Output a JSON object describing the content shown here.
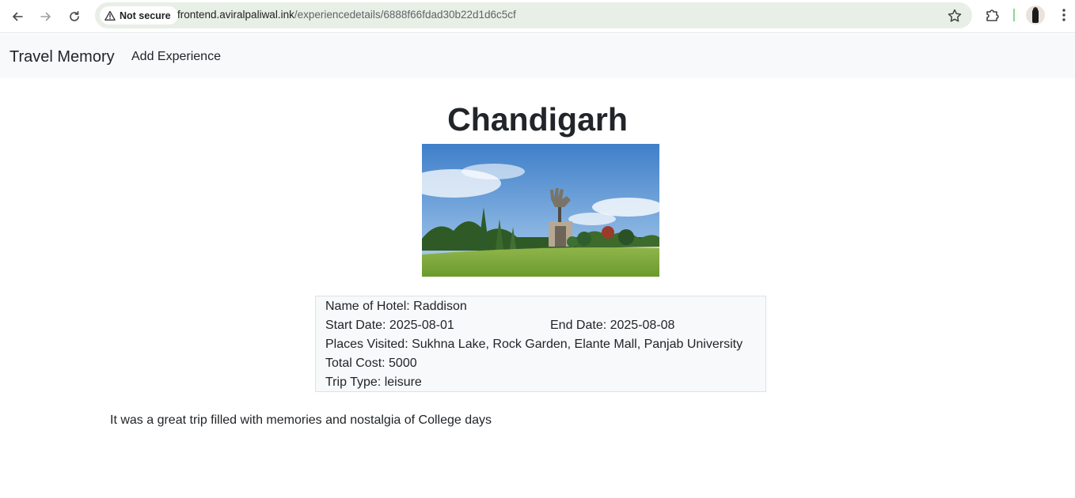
{
  "browser": {
    "security_label": "Not secure",
    "url_host": "frontend.aviralpaliwal.ink",
    "url_path": "/experiencedetails/6888f66fdad30b22d1d6c5cf"
  },
  "navbar": {
    "brand": "Travel Memory",
    "add_experience": "Add Experience"
  },
  "experience": {
    "city": "Chandigarh",
    "hotel": "Name of Hotel: Raddison",
    "start_date": "Start Date: 2025-08-01",
    "end_date": "End Date: 2025-08-08",
    "places": "Places Visited: Sukhna Lake, Rock Garden, Elante Mall, Panjab University",
    "total_cost": "Total Cost: 5000",
    "trip_type": "Trip Type: leisure",
    "description": "It was a great trip filled with memories and nostalgia of College days"
  },
  "icons": {
    "back": "arrow-left-icon",
    "forward": "arrow-right-icon",
    "reload": "reload-icon",
    "warning": "warning-triangle-icon",
    "bookmark": "star-icon",
    "extensions": "puzzle-icon",
    "menu": "kebab-menu-icon"
  },
  "colors": {
    "navbar_bg": "#f8f9fa",
    "omnibox_bg": "#e8efe6",
    "text": "#212529"
  }
}
